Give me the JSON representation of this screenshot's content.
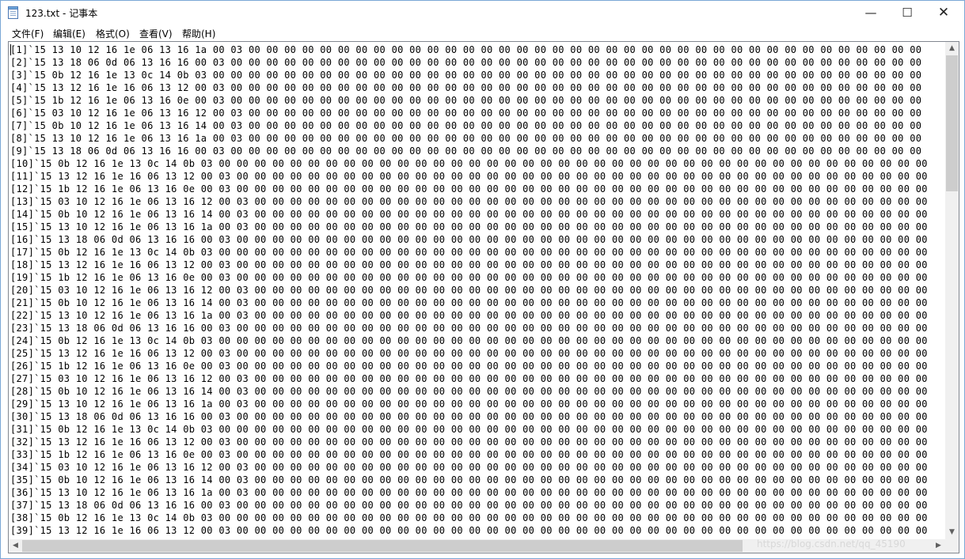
{
  "window": {
    "title": "123.txt - 记事本",
    "icon": "notepad-icon",
    "buttons": {
      "minimize": "—",
      "maximize": "☐",
      "close": "✕"
    }
  },
  "menu": [
    "文件(F)",
    "编辑(E)",
    "格式(O)",
    "查看(V)",
    "帮助(H)"
  ],
  "editor": {
    "lines": [
      "[1]`15 13 10 12 16 1e 06 13 16 1a 00 03 00 00 00 00 00 00 00 00 00 00 00 00 00 00 00 00 00 00 00 00 00 00 00 00 00 00 00 00 00 00 00 00 00 00 00 00 00 00",
      "[2]`15 13 18 06 0d 06 13 16 16 00 03 00 00 00 00 00 00 00 00 00 00 00 00 00 00 00 00 00 00 00 00 00 00 00 00 00 00 00 00 00 00 00 00 00 00 00 00 00 00 00",
      "[3]`15 0b 12 16 1e 13 0c 14 0b 03 00 00 00 00 00 00 00 00 00 00 00 00 00 00 00 00 00 00 00 00 00 00 00 00 00 00 00 00 00 00 00 00 00 00 00 00 00 00 00 00",
      "[4]`15 13 12 16 1e 16 06 13 12 00 03 00 00 00 00 00 00 00 00 00 00 00 00 00 00 00 00 00 00 00 00 00 00 00 00 00 00 00 00 00 00 00 00 00 00 00 00 00 00 00",
      "[5]`15 1b 12 16 1e 06 13 16 0e 00 03 00 00 00 00 00 00 00 00 00 00 00 00 00 00 00 00 00 00 00 00 00 00 00 00 00 00 00 00 00 00 00 00 00 00 00 00 00 00 00",
      "[6]`15 03 10 12 16 1e 06 13 16 12 00 03 00 00 00 00 00 00 00 00 00 00 00 00 00 00 00 00 00 00 00 00 00 00 00 00 00 00 00 00 00 00 00 00 00 00 00 00 00 00",
      "[7]`15 0b 10 12 16 1e 06 13 16 14 00 03 00 00 00 00 00 00 00 00 00 00 00 00 00 00 00 00 00 00 00 00 00 00 00 00 00 00 00 00 00 00 00 00 00 00 00 00 00 00",
      "[8]`15 13 10 12 16 1e 06 13 16 1a 00 03 00 00 00 00 00 00 00 00 00 00 00 00 00 00 00 00 00 00 00 00 00 00 00 00 00 00 00 00 00 00 00 00 00 00 00 00 00 00",
      "[9]`15 13 18 06 0d 06 13 16 16 00 03 00 00 00 00 00 00 00 00 00 00 00 00 00 00 00 00 00 00 00 00 00 00 00 00 00 00 00 00 00 00 00 00 00 00 00 00 00 00 00",
      "[10]`15 0b 12 16 1e 13 0c 14 0b 03 00 00 00 00 00 00 00 00 00 00 00 00 00 00 00 00 00 00 00 00 00 00 00 00 00 00 00 00 00 00 00 00 00 00 00 00 00 00 00 00",
      "[11]`15 13 12 16 1e 16 06 13 12 00 03 00 00 00 00 00 00 00 00 00 00 00 00 00 00 00 00 00 00 00 00 00 00 00 00 00 00 00 00 00 00 00 00 00 00 00 00 00 00 00",
      "[12]`15 1b 12 16 1e 06 13 16 0e 00 03 00 00 00 00 00 00 00 00 00 00 00 00 00 00 00 00 00 00 00 00 00 00 00 00 00 00 00 00 00 00 00 00 00 00 00 00 00 00 00",
      "[13]`15 03 10 12 16 1e 06 13 16 12 00 03 00 00 00 00 00 00 00 00 00 00 00 00 00 00 00 00 00 00 00 00 00 00 00 00 00 00 00 00 00 00 00 00 00 00 00 00 00 00",
      "[14]`15 0b 10 12 16 1e 06 13 16 14 00 03 00 00 00 00 00 00 00 00 00 00 00 00 00 00 00 00 00 00 00 00 00 00 00 00 00 00 00 00 00 00 00 00 00 00 00 00 00 00",
      "[15]`15 13 10 12 16 1e 06 13 16 1a 00 03 00 00 00 00 00 00 00 00 00 00 00 00 00 00 00 00 00 00 00 00 00 00 00 00 00 00 00 00 00 00 00 00 00 00 00 00 00 00",
      "[16]`15 13 18 06 0d 06 13 16 16 00 03 00 00 00 00 00 00 00 00 00 00 00 00 00 00 00 00 00 00 00 00 00 00 00 00 00 00 00 00 00 00 00 00 00 00 00 00 00 00 00",
      "[17]`15 0b 12 16 1e 13 0c 14 0b 03 00 00 00 00 00 00 00 00 00 00 00 00 00 00 00 00 00 00 00 00 00 00 00 00 00 00 00 00 00 00 00 00 00 00 00 00 00 00 00 00",
      "[18]`15 13 12 16 1e 16 06 13 12 00 03 00 00 00 00 00 00 00 00 00 00 00 00 00 00 00 00 00 00 00 00 00 00 00 00 00 00 00 00 00 00 00 00 00 00 00 00 00 00 00",
      "[19]`15 1b 12 16 1e 06 13 16 0e 00 03 00 00 00 00 00 00 00 00 00 00 00 00 00 00 00 00 00 00 00 00 00 00 00 00 00 00 00 00 00 00 00 00 00 00 00 00 00 00 00",
      "[20]`15 03 10 12 16 1e 06 13 16 12 00 03 00 00 00 00 00 00 00 00 00 00 00 00 00 00 00 00 00 00 00 00 00 00 00 00 00 00 00 00 00 00 00 00 00 00 00 00 00 00",
      "[21]`15 0b 10 12 16 1e 06 13 16 14 00 03 00 00 00 00 00 00 00 00 00 00 00 00 00 00 00 00 00 00 00 00 00 00 00 00 00 00 00 00 00 00 00 00 00 00 00 00 00 00",
      "[22]`15 13 10 12 16 1e 06 13 16 1a 00 03 00 00 00 00 00 00 00 00 00 00 00 00 00 00 00 00 00 00 00 00 00 00 00 00 00 00 00 00 00 00 00 00 00 00 00 00 00 00",
      "[23]`15 13 18 06 0d 06 13 16 16 00 03 00 00 00 00 00 00 00 00 00 00 00 00 00 00 00 00 00 00 00 00 00 00 00 00 00 00 00 00 00 00 00 00 00 00 00 00 00 00 00",
      "[24]`15 0b 12 16 1e 13 0c 14 0b 03 00 00 00 00 00 00 00 00 00 00 00 00 00 00 00 00 00 00 00 00 00 00 00 00 00 00 00 00 00 00 00 00 00 00 00 00 00 00 00 00",
      "[25]`15 13 12 16 1e 16 06 13 12 00 03 00 00 00 00 00 00 00 00 00 00 00 00 00 00 00 00 00 00 00 00 00 00 00 00 00 00 00 00 00 00 00 00 00 00 00 00 00 00 00",
      "[26]`15 1b 12 16 1e 06 13 16 0e 00 03 00 00 00 00 00 00 00 00 00 00 00 00 00 00 00 00 00 00 00 00 00 00 00 00 00 00 00 00 00 00 00 00 00 00 00 00 00 00 00",
      "[27]`15 03 10 12 16 1e 06 13 16 12 00 03 00 00 00 00 00 00 00 00 00 00 00 00 00 00 00 00 00 00 00 00 00 00 00 00 00 00 00 00 00 00 00 00 00 00 00 00 00 00",
      "[28]`15 0b 10 12 16 1e 06 13 16 14 00 03 00 00 00 00 00 00 00 00 00 00 00 00 00 00 00 00 00 00 00 00 00 00 00 00 00 00 00 00 00 00 00 00 00 00 00 00 00 00",
      "[29]`15 13 10 12 16 1e 06 13 16 1a 00 03 00 00 00 00 00 00 00 00 00 00 00 00 00 00 00 00 00 00 00 00 00 00 00 00 00 00 00 00 00 00 00 00 00 00 00 00 00 00",
      "[30]`15 13 18 06 0d 06 13 16 16 00 03 00 00 00 00 00 00 00 00 00 00 00 00 00 00 00 00 00 00 00 00 00 00 00 00 00 00 00 00 00 00 00 00 00 00 00 00 00 00 00",
      "[31]`15 0b 12 16 1e 13 0c 14 0b 03 00 00 00 00 00 00 00 00 00 00 00 00 00 00 00 00 00 00 00 00 00 00 00 00 00 00 00 00 00 00 00 00 00 00 00 00 00 00 00 00",
      "[32]`15 13 12 16 1e 16 06 13 12 00 03 00 00 00 00 00 00 00 00 00 00 00 00 00 00 00 00 00 00 00 00 00 00 00 00 00 00 00 00 00 00 00 00 00 00 00 00 00 00 00",
      "[33]`15 1b 12 16 1e 06 13 16 0e 00 03 00 00 00 00 00 00 00 00 00 00 00 00 00 00 00 00 00 00 00 00 00 00 00 00 00 00 00 00 00 00 00 00 00 00 00 00 00 00 00",
      "[34]`15 03 10 12 16 1e 06 13 16 12 00 03 00 00 00 00 00 00 00 00 00 00 00 00 00 00 00 00 00 00 00 00 00 00 00 00 00 00 00 00 00 00 00 00 00 00 00 00 00 00",
      "[35]`15 0b 10 12 16 1e 06 13 16 14 00 03 00 00 00 00 00 00 00 00 00 00 00 00 00 00 00 00 00 00 00 00 00 00 00 00 00 00 00 00 00 00 00 00 00 00 00 00 00 00",
      "[36]`15 13 10 12 16 1e 06 13 16 1a 00 03 00 00 00 00 00 00 00 00 00 00 00 00 00 00 00 00 00 00 00 00 00 00 00 00 00 00 00 00 00 00 00 00 00 00 00 00 00 00",
      "[37]`15 13 18 06 0d 06 13 16 16 00 03 00 00 00 00 00 00 00 00 00 00 00 00 00 00 00 00 00 00 00 00 00 00 00 00 00 00 00 00 00 00 00 00 00 00 00 00 00 00 00",
      "[38]`15 0b 12 16 1e 13 0c 14 0b 03 00 00 00 00 00 00 00 00 00 00 00 00 00 00 00 00 00 00 00 00 00 00 00 00 00 00 00 00 00 00 00 00 00 00 00 00 00 00 00 00",
      "[39]`15 13 12 16 1e 16 06 13 12 00 03 00 00 00 00 00 00 00 00 00 00 00 00 00 00 00 00 00 00 00 00 00 00 00 00 00 00 00 00 00 00 00 00 00 00 00 00 00 00 00"
    ]
  },
  "scrollbars": {
    "vertical": {
      "up": "▲",
      "down": "▼"
    },
    "horizontal": {
      "left": "◀",
      "right": "▶"
    }
  },
  "watermark": "https://blog.csdn.net/qq_45190"
}
